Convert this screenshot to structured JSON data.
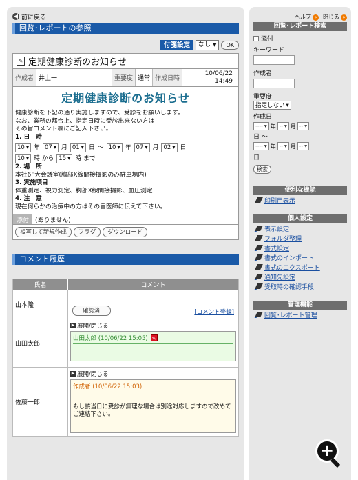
{
  "nav": {
    "back": "前に戻る"
  },
  "section_title": "回覧･レポートの参照",
  "tagbar": {
    "label": "付箋設定",
    "select": "なし",
    "ok": "OK"
  },
  "doc": {
    "title": "定期健康診断のお知らせ",
    "author_label": "作成者",
    "author": "井上一",
    "importance_label": "重要度",
    "importance": "通常",
    "date_label": "作成日時",
    "date": "10/06/22",
    "time": "14:49",
    "heading": "定期健康診断のお知らせ",
    "intro": [
      "健康診断を下記の通り実施しますので、受診をお願いします。",
      "なお、業務の都合上、指定日時に受診出来ない方は",
      "その旨コメント欄にご記入下さい。"
    ],
    "sec1": "1. 日　時",
    "date_from": {
      "year": "10",
      "y_unit": "年",
      "month": "07",
      "m_unit": "月",
      "day": "01",
      "d_unit": "日",
      "sep": "〜"
    },
    "date_to": {
      "year": "10",
      "y_unit": "年",
      "month": "07",
      "m_unit": "月",
      "day": "02",
      "d_unit": "日"
    },
    "time_from": "10",
    "time_unit1": "時 から",
    "time_to": "15",
    "time_unit2": "時 まで",
    "sec2": "2. 場　所",
    "place": "本社6F大会議室(胸部X線間接撮影のみ駐車場内)",
    "sec3": "3. 実施項目",
    "items": "体重測定、視力測定、胸部X線間接撮影、血圧測定",
    "sec4": "4. 注　意",
    "note": "現在何らかの治療中の方はその旨医師に伝えて下さい。",
    "attach_label": "添付",
    "attach_value": "(ありません)",
    "buttons": {
      "copy": "複写して新規作成",
      "flag": "フラグ",
      "download": "ダウンロード"
    }
  },
  "comments": {
    "title": "コメント履歴",
    "col_name": "氏名",
    "col_comment": "コメント",
    "rows": [
      {
        "name": "山本隆",
        "confirm": "確認済",
        "add": "[コメント登録]"
      },
      {
        "name": "山田太郎",
        "toggle": "展開/閉じる",
        "header": "山田太郎 (10/06/22 15:05)"
      },
      {
        "name": "佐藤一郎",
        "toggle": "展開/閉じる",
        "header": "作成者 (10/06/22 15:03)",
        "text": "もし該当日に受診が無理な場合は別途対応しますので改めてご連絡下さい。"
      }
    ]
  },
  "sidebar": {
    "help": "ヘルプ",
    "close": "閉じる",
    "search_title": "回覧･レポート検索",
    "attach_check": "添付",
    "keyword_label": "キーワード",
    "author_label": "作成者",
    "importance_label": "重要度",
    "importance_value": "指定しない",
    "date_label": "作成日",
    "date_from": {
      "y": "----",
      "y_unit": "年",
      "m": "--",
      "m_unit": "月",
      "d": "--"
    },
    "day_unit": "日",
    "tilde": "日 〜",
    "date_to": {
      "y": "----",
      "y_unit": "年",
      "m": "--",
      "m_unit": "月",
      "d": "--"
    },
    "day_unit2": "日",
    "search_button": "検索",
    "useful_title": "便利な機能",
    "useful": [
      "印刷用表示"
    ],
    "personal_title": "個人設定",
    "personal": [
      "表示設定",
      "フォルダ整理",
      "書式設定",
      "書式のインポート",
      "書式のエクスポート",
      "通知先設定",
      "受取時の確認手段"
    ],
    "admin_title": "管理機能",
    "admin": [
      "回覧･レポート管理"
    ]
  }
}
